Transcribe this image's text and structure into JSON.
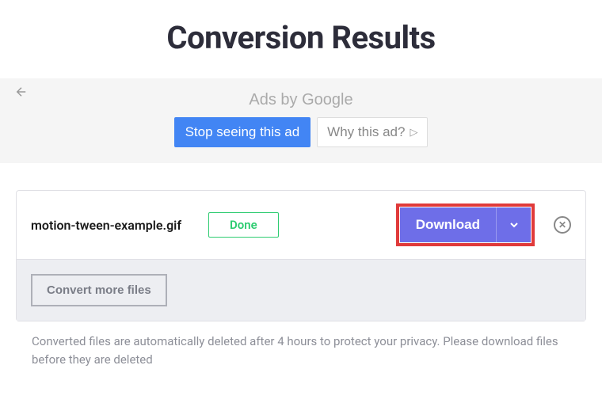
{
  "title": "Conversion Results",
  "ad": {
    "header_prefix": "Ads by ",
    "google": "Google",
    "stop_label": "Stop seeing this ad",
    "why_label": "Why this ad?"
  },
  "file": {
    "name": "motion-tween-example.gif",
    "status": "Done",
    "download_label": "Download"
  },
  "convert_more_label": "Convert more files",
  "footer_note": "Converted files are automatically deleted after 4 hours to protect your privacy. Please download files before they are deleted"
}
